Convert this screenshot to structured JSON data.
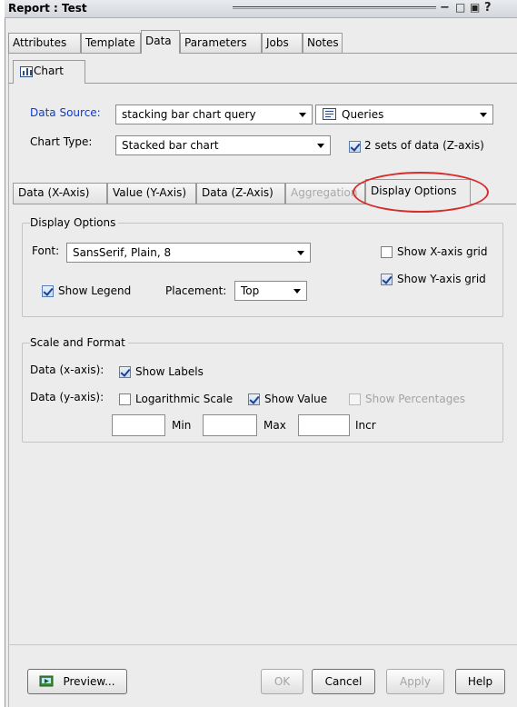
{
  "window": {
    "title": "Report : Test",
    "controls": [
      "−",
      "□",
      "▣",
      "?"
    ]
  },
  "top_tabs": [
    {
      "label": "Attributes",
      "active": false
    },
    {
      "label": "Template",
      "active": false
    },
    {
      "label": "Data",
      "active": true
    },
    {
      "label": "Parameters",
      "active": false
    },
    {
      "label": "Jobs",
      "active": false
    },
    {
      "label": "Notes",
      "active": false
    }
  ],
  "chart_tab": {
    "label": "Chart",
    "icon": "bar-chart-icon"
  },
  "data_source": {
    "label": "Data Source:",
    "value": "stacking bar chart query",
    "queries_value": "Queries",
    "queries_icon": "query-icon"
  },
  "chart_type": {
    "label": "Chart Type:",
    "value": "Stacked bar chart",
    "z_axis_label": "2 sets of data (Z-axis)",
    "z_axis_checked": true
  },
  "sub_tabs": [
    {
      "label": "Data (X-Axis)",
      "state": "normal"
    },
    {
      "label": "Value (Y-Axis)",
      "state": "normal"
    },
    {
      "label": "Data (Z-Axis)",
      "state": "normal"
    },
    {
      "label": "Aggregation",
      "state": "disabled"
    },
    {
      "label": "Display Options",
      "state": "active"
    }
  ],
  "display_options": {
    "title": "Display Options",
    "font_label": "Font:",
    "font_value": "SansSerif, Plain, 8",
    "show_legend_label": "Show Legend",
    "show_legend_checked": true,
    "placement_label": "Placement:",
    "placement_value": "Top",
    "show_x_grid_label": "Show X-axis grid",
    "show_x_grid_checked": false,
    "show_y_grid_label": "Show Y-axis grid",
    "show_y_grid_checked": true
  },
  "scale_format": {
    "title": "Scale and Format",
    "x_axis_label": "Data (x-axis):",
    "show_labels_label": "Show Labels",
    "show_labels_checked": true,
    "y_axis_label": "Data (y-axis):",
    "log_scale_label": "Logarithmic Scale",
    "log_scale_checked": false,
    "show_value_label": "Show Value",
    "show_value_checked": true,
    "show_percentages_label": "Show Percentages",
    "show_percentages_checked": false,
    "min_label": "Min",
    "max_label": "Max",
    "incr_label": "Incr",
    "min_value": "",
    "max_value": "",
    "incr_value": ""
  },
  "buttons": {
    "preview": "Preview...",
    "ok": "OK",
    "cancel": "Cancel",
    "apply": "Apply",
    "help": "Help"
  },
  "colors": {
    "highlight": "#d62c2c",
    "label_blue": "#0b3bd1"
  }
}
